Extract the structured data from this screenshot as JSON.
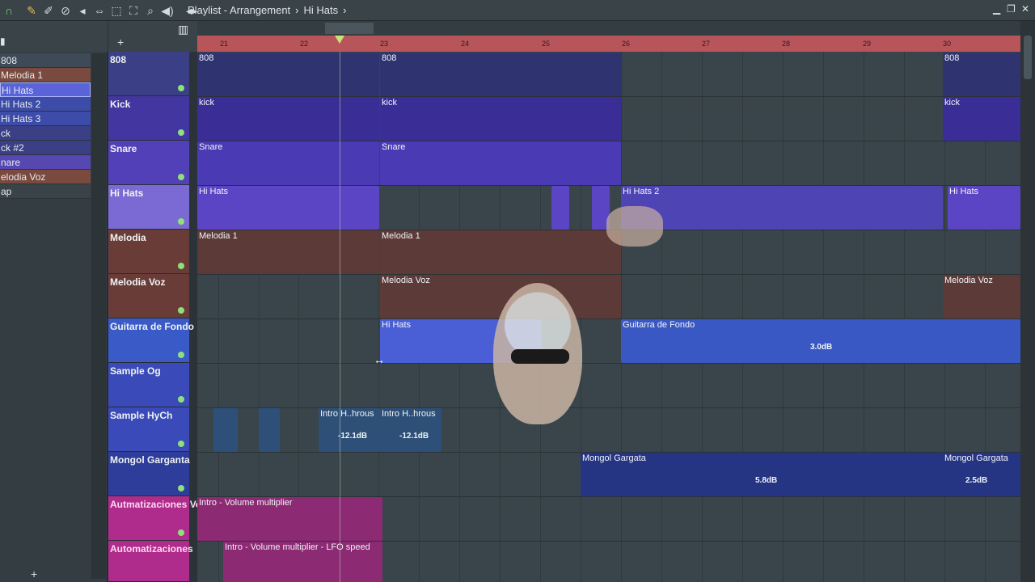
{
  "toolbar": {
    "title_parts": [
      "Playlist - Arrangement",
      "Hi Hats"
    ],
    "icons": [
      "magnet-icon",
      "pencil-icon",
      "brush-icon",
      "mute-icon",
      "speaker-icon",
      "slip-icon",
      "select-icon",
      "zoom-icon",
      "playback-icon"
    ]
  },
  "patterns": [
    {
      "label": "808",
      "color": "#3e5a7a"
    },
    {
      "label": "Melodia 1",
      "color": "#7a4a3e"
    },
    {
      "label": "Hi Hats",
      "color": "#5a63d8"
    },
    {
      "label": "Hi Hats 2",
      "color": "#3c4ca8"
    },
    {
      "label": "Hi Hats 3",
      "color": "#3c4ca8"
    },
    {
      "label": "ck",
      "color": "#3a3f86"
    },
    {
      "label": "ck #2",
      "color": "#3a3f86"
    },
    {
      "label": "nare",
      "color": "#5648b0"
    },
    {
      "label": "elodia Voz",
      "color": "#7a4a3e"
    },
    {
      "label": "ap",
      "color": "#3a4347"
    }
  ],
  "pattern_top_label": "ᕦ",
  "ruler": [
    "21",
    "22",
    "23",
    "24",
    "25",
    "26",
    "27",
    "28",
    "29",
    "30"
  ],
  "tracks": [
    {
      "name": "808",
      "color": "#3b3f86"
    },
    {
      "name": "Kick",
      "color": "#4436a0"
    },
    {
      "name": "Snare",
      "color": "#5240b8"
    },
    {
      "name": "Hi Hats",
      "color": "#7c6ad4"
    },
    {
      "name": "Melodia",
      "color": "#6a3c38"
    },
    {
      "name": "Melodia Voz",
      "color": "#6a3c38"
    },
    {
      "name": "Guitarra de Fondo",
      "color": "#3a5ac8"
    },
    {
      "name": "Sample Og",
      "color": "#3a4ab8"
    },
    {
      "name": "Sample HyCh",
      "color": "#3a4ab8"
    },
    {
      "name": "Mongol Garganta",
      "color": "#2e3c9a"
    },
    {
      "name": "Autmatizaciones Vol",
      "color": "#b02c8c"
    },
    {
      "name": "Automatizaciones",
      "color": "#b02c8c"
    }
  ],
  "clips": {
    "c808a": "808",
    "c808b": "808",
    "c808c": "808",
    "kicka": "kick",
    "kickb": "kick",
    "kickc": "kick",
    "snarea": "Snare",
    "snareb": "Snare",
    "hha": "Hi Hats",
    "hhb": "Hi Hats 2",
    "hhc": "Hi Hats",
    "mela": "Melodia 1",
    "melb": "Melodia 1",
    "voza": "Melodia Voz",
    "vozb": "Melodia Voz",
    "hhg": "Hi Hats",
    "guit": "Guitarra de Fondo",
    "intro1": "Intro H..hrous",
    "intro2": "Intro H..hrous",
    "mong1": "Mongol Gargata",
    "mong2": "Mongol Gargata",
    "auto1": "Intro - Volume multiplier",
    "auto2": "Intro - Volume multiplier - LFO speed"
  },
  "levels": {
    "guit": "3.0dB",
    "intro1": "-12.1dB",
    "intro2": "-12.1dB",
    "mong1": "5.8dB",
    "mong2": "2.5dB"
  },
  "colors": {
    "purple_clip": "#5b45c4",
    "blue_clip": "#4a5fd6",
    "brown_clip": "#7a4a40",
    "magenta": "#b02c8c",
    "ruler": "#b8555a"
  }
}
